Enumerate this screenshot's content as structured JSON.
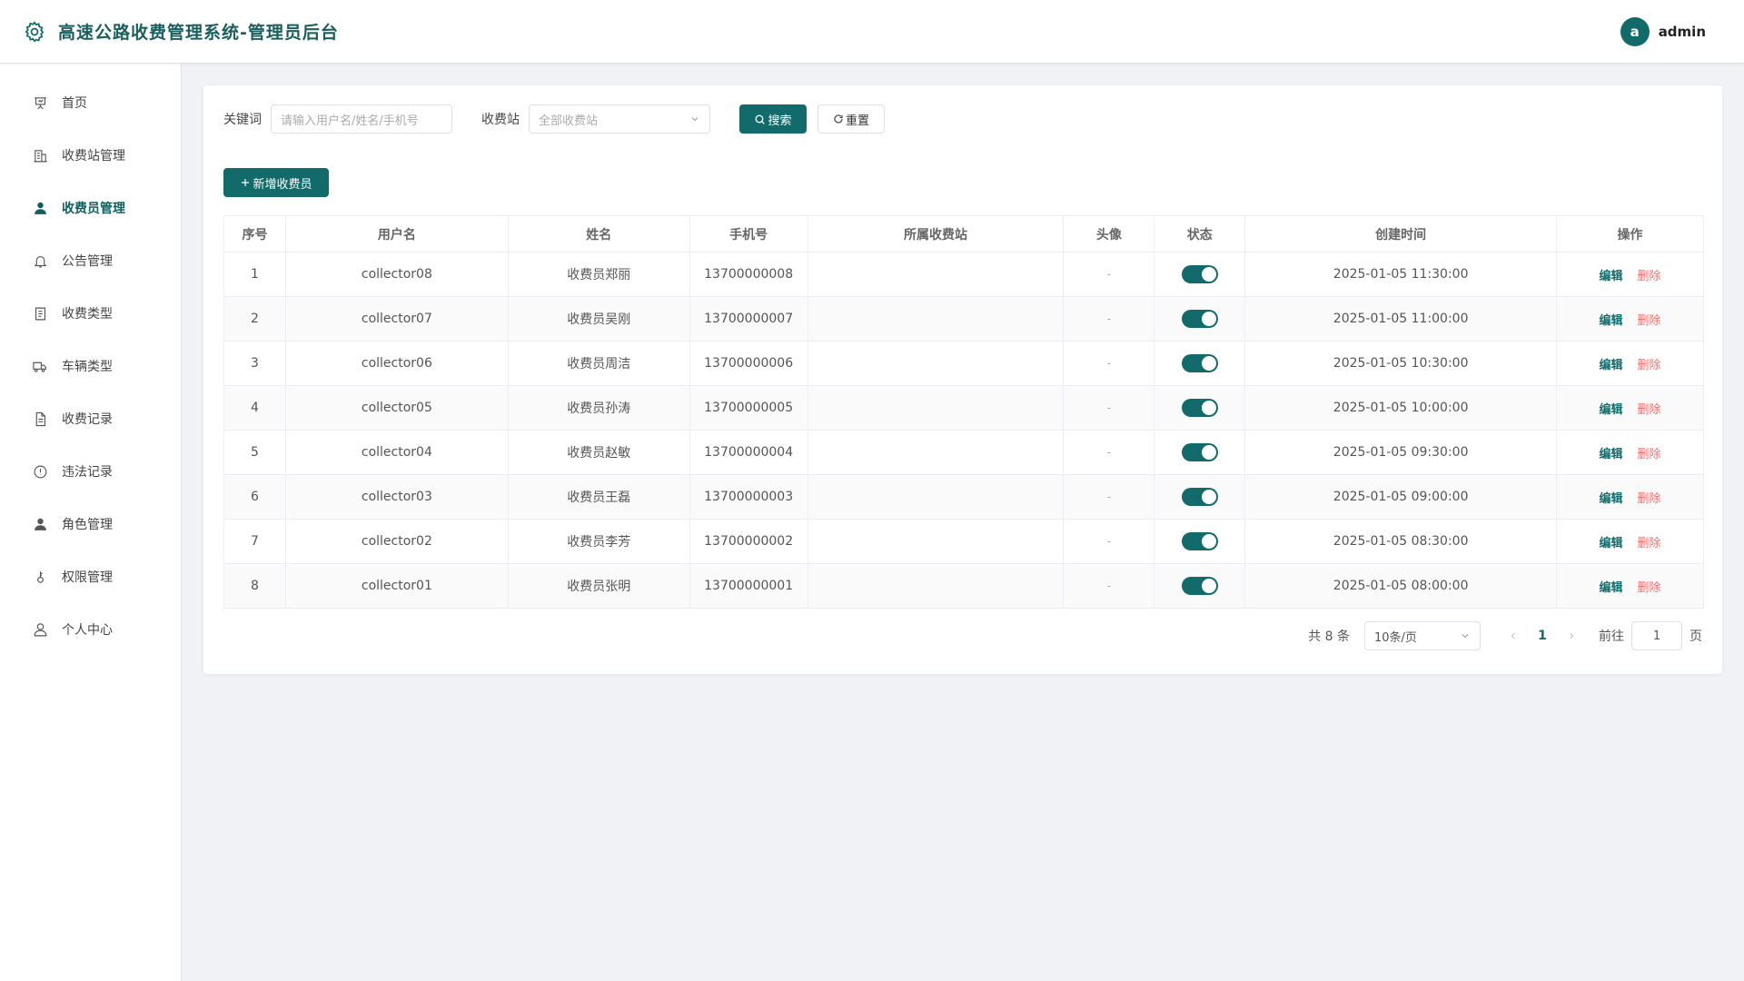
{
  "header": {
    "title": "高速公路收费管理系统-管理员后台",
    "logo_icon": "gear-icon",
    "user": {
      "avatar_letter": "a",
      "name": "admin"
    }
  },
  "sidebar": {
    "items": [
      {
        "label": "首页",
        "icon": "presentation-icon",
        "active": false
      },
      {
        "label": "收费站管理",
        "icon": "building-icon",
        "active": false
      },
      {
        "label": "收费员管理",
        "icon": "user-icon",
        "active": true
      },
      {
        "label": "公告管理",
        "icon": "bell-icon",
        "active": false
      },
      {
        "label": "收费类型",
        "icon": "document-icon",
        "active": false
      },
      {
        "label": "车辆类型",
        "icon": "truck-icon",
        "active": false
      },
      {
        "label": "收费记录",
        "icon": "file-text-icon",
        "active": false
      },
      {
        "label": "违法记录",
        "icon": "warning-icon",
        "active": false
      },
      {
        "label": "角色管理",
        "icon": "user-icon",
        "active": false
      },
      {
        "label": "权限管理",
        "icon": "key-icon",
        "active": false
      },
      {
        "label": "个人中心",
        "icon": "user-outline-icon",
        "active": false
      }
    ]
  },
  "filters": {
    "keyword_label": "关键词",
    "keyword_placeholder": "请输入用户名/姓名/手机号",
    "station_label": "收费站",
    "station_value": "全部收费站",
    "search_label": "搜索",
    "reset_label": "重置"
  },
  "add_button_label": "新增收费员",
  "table": {
    "columns": [
      "序号",
      "用户名",
      "姓名",
      "手机号",
      "所属收费站",
      "头像",
      "状态",
      "创建时间",
      "操作"
    ],
    "rows": [
      {
        "index": "1",
        "username": "collector08",
        "name": "收费员郑丽",
        "phone": "13700000008",
        "station": "",
        "avatar": "-",
        "enabled": true,
        "created": "2025-01-05 11:30:00"
      },
      {
        "index": "2",
        "username": "collector07",
        "name": "收费员吴刚",
        "phone": "13700000007",
        "station": "",
        "avatar": "-",
        "enabled": true,
        "created": "2025-01-05 11:00:00"
      },
      {
        "index": "3",
        "username": "collector06",
        "name": "收费员周洁",
        "phone": "13700000006",
        "station": "",
        "avatar": "-",
        "enabled": true,
        "created": "2025-01-05 10:30:00"
      },
      {
        "index": "4",
        "username": "collector05",
        "name": "收费员孙涛",
        "phone": "13700000005",
        "station": "",
        "avatar": "-",
        "enabled": true,
        "created": "2025-01-05 10:00:00"
      },
      {
        "index": "5",
        "username": "collector04",
        "name": "收费员赵敏",
        "phone": "13700000004",
        "station": "",
        "avatar": "-",
        "enabled": true,
        "created": "2025-01-05 09:30:00"
      },
      {
        "index": "6",
        "username": "collector03",
        "name": "收费员王磊",
        "phone": "13700000003",
        "station": "",
        "avatar": "-",
        "enabled": true,
        "created": "2025-01-05 09:00:00"
      },
      {
        "index": "7",
        "username": "collector02",
        "name": "收费员李芳",
        "phone": "13700000002",
        "station": "",
        "avatar": "-",
        "enabled": true,
        "created": "2025-01-05 08:30:00"
      },
      {
        "index": "8",
        "username": "collector01",
        "name": "收费员张明",
        "phone": "13700000001",
        "station": "",
        "avatar": "-",
        "enabled": true,
        "created": "2025-01-05 08:00:00"
      }
    ],
    "edit_label": "编辑",
    "delete_label": "删除"
  },
  "pagination": {
    "total_text": "共 8 条",
    "page_size": "10条/页",
    "current_page": "1",
    "goto_label": "前往",
    "goto_value": "1",
    "page_suffix": "页"
  },
  "colors": {
    "primary": "#136a6a",
    "danger": "#f56c6c",
    "background": "#f0f2f5"
  }
}
